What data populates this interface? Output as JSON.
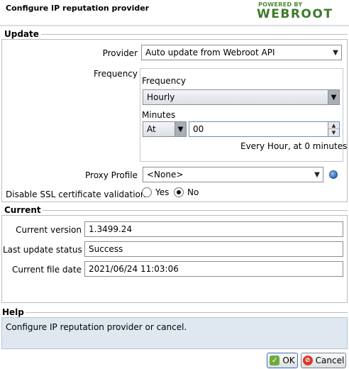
{
  "window": {
    "title": "Configure IP reputation provider",
    "logo_powered": "POWERED BY",
    "logo_name": "WEBROOT"
  },
  "update": {
    "header": "Update",
    "provider_label": "Provider",
    "provider_value": "Auto update from Webroot API",
    "frequency_label": "Frequency",
    "frequency_inner_label": "Frequency",
    "frequency_value": "Hourly",
    "minutes_label": "Minutes",
    "minutes_mode": "At",
    "minutes_value": "00",
    "schedule_summary": "Every Hour, at 0 minutes",
    "proxy_label": "Proxy Profile",
    "proxy_value": "<None>",
    "ssl_label": "Disable SSL certificate validation",
    "ssl_yes": "Yes",
    "ssl_no": "No",
    "ssl_selected": "No"
  },
  "current": {
    "header": "Current",
    "version_label": "Current version",
    "version_value": "1.3499.24",
    "status_label": "Last update status",
    "status_value": "Success",
    "file_date_label": "Current file date",
    "file_date_value": "2021/06/24 11:03:06"
  },
  "help": {
    "header": "Help",
    "text": "Configure IP reputation provider or cancel."
  },
  "buttons": {
    "ok": "OK",
    "cancel": "Cancel"
  },
  "icons": {
    "combo_arrow": "chevron-down-icon",
    "spin_up": "chevron-up-icon",
    "spin_down": "chevron-down-icon",
    "proxy": "globe-icon",
    "ok": "check-icon",
    "cancel": "cancel-icon"
  },
  "colors": {
    "brand_green": "#3d7a2a",
    "help_background": "#dfe8f1",
    "ok_icon": "#6dab3c",
    "cancel_icon": "#d63a2f"
  }
}
